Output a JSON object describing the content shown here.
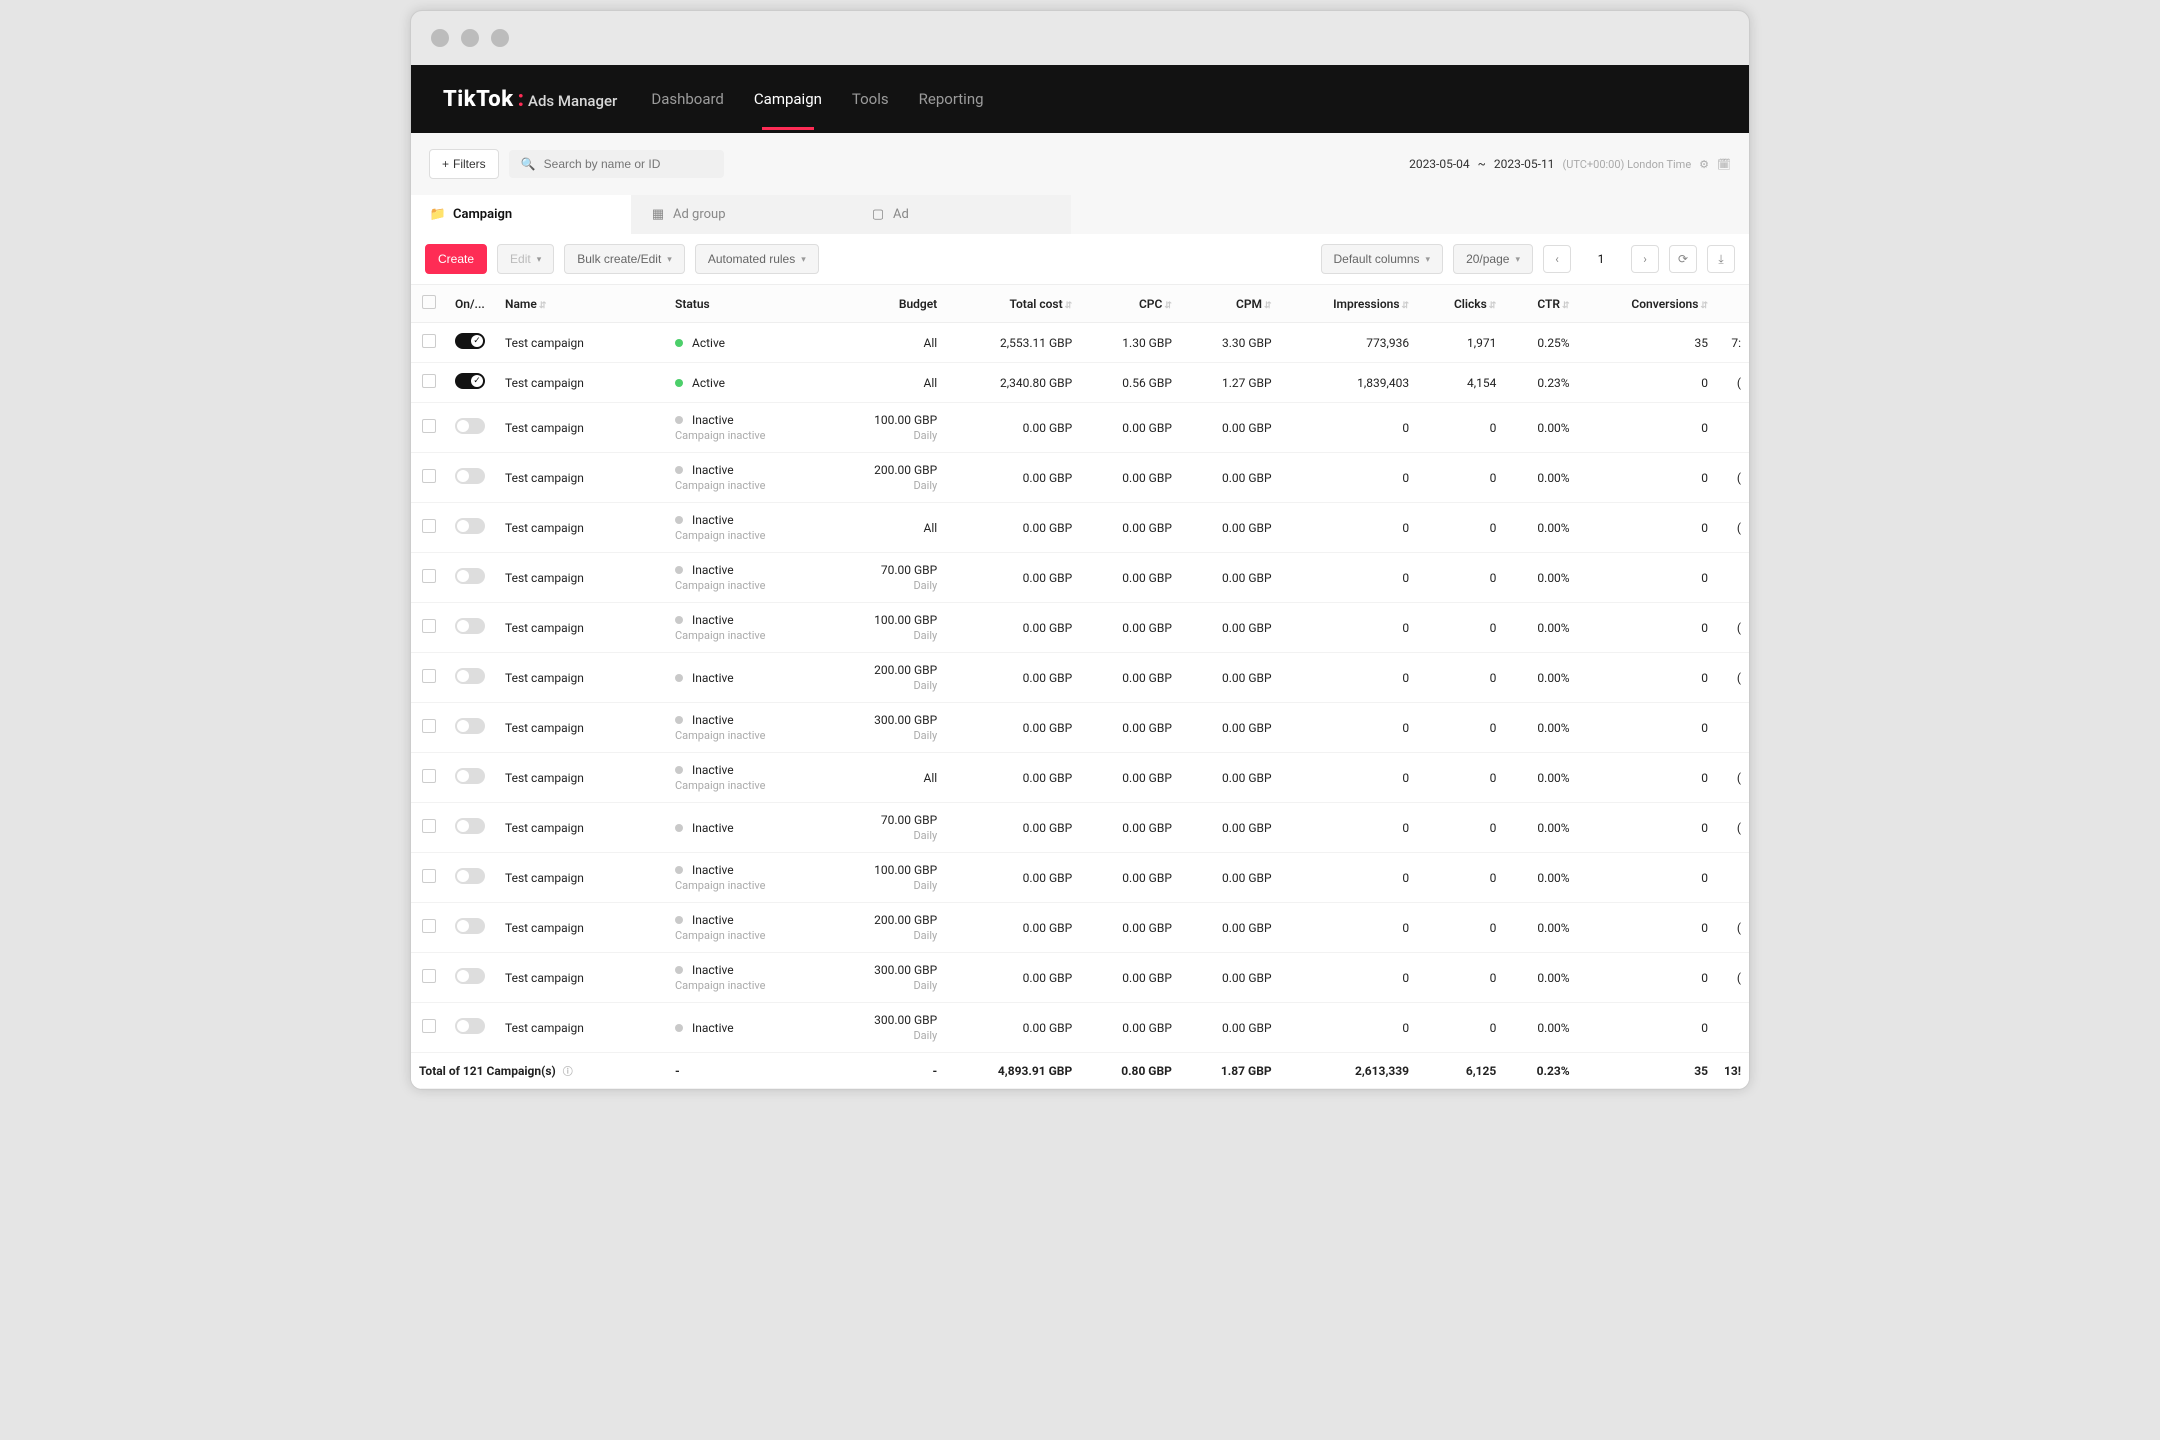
{
  "brand": {
    "name": "TikTok",
    "suffix": "Ads Manager"
  },
  "nav": {
    "dashboard": "Dashboard",
    "campaign": "Campaign",
    "tools": "Tools",
    "reporting": "Reporting"
  },
  "filters": {
    "button": "Filters",
    "search_placeholder": "Search by name or ID",
    "date_from": "2023-05-04",
    "date_to": "2023-05-11",
    "tz": "(UTC+00:00) London Time"
  },
  "tabs": {
    "campaign": "Campaign",
    "adgroup": "Ad group",
    "ad": "Ad"
  },
  "toolbar": {
    "create": "Create",
    "edit": "Edit",
    "bulk": "Bulk create/Edit",
    "rules": "Automated rules",
    "columns": "Default columns",
    "per_page": "20/page",
    "page": "1"
  },
  "columns": {
    "onoff": "On/...",
    "name": "Name",
    "status": "Status",
    "budget": "Budget",
    "total_cost": "Total cost",
    "cpc": "CPC",
    "cpm": "CPM",
    "impressions": "Impressions",
    "clicks": "Clicks",
    "ctr": "CTR",
    "conversions": "Conversions"
  },
  "rows": [
    {
      "on": true,
      "name": "Test campaign",
      "status": "Active",
      "note": "",
      "budget": "All",
      "budget_sub": "",
      "cost": "2,553.11 GBP",
      "cpc": "1.30 GBP",
      "cpm": "3.30 GBP",
      "impr": "773,936",
      "clicks": "1,971",
      "ctr": "0.25%",
      "conv": "35",
      "tail": "7:"
    },
    {
      "on": true,
      "name": "Test campaign",
      "status": "Active",
      "note": "",
      "budget": "All",
      "budget_sub": "",
      "cost": "2,340.80 GBP",
      "cpc": "0.56 GBP",
      "cpm": "1.27 GBP",
      "impr": "1,839,403",
      "clicks": "4,154",
      "ctr": "0.23%",
      "conv": "0",
      "tail": "("
    },
    {
      "on": false,
      "name": "Test campaign",
      "status": "Inactive",
      "note": "Campaign inactive",
      "budget": "100.00 GBP",
      "budget_sub": "Daily",
      "cost": "0.00 GBP",
      "cpc": "0.00 GBP",
      "cpm": "0.00 GBP",
      "impr": "0",
      "clicks": "0",
      "ctr": "0.00%",
      "conv": "0",
      "tail": ""
    },
    {
      "on": false,
      "name": "Test campaign",
      "status": "Inactive",
      "note": "Campaign inactive",
      "budget": "200.00 GBP",
      "budget_sub": "Daily",
      "cost": "0.00 GBP",
      "cpc": "0.00 GBP",
      "cpm": "0.00 GBP",
      "impr": "0",
      "clicks": "0",
      "ctr": "0.00%",
      "conv": "0",
      "tail": "("
    },
    {
      "on": false,
      "name": "Test campaign",
      "status": "Inactive",
      "note": "Campaign inactive",
      "budget": "All",
      "budget_sub": "",
      "cost": "0.00 GBP",
      "cpc": "0.00 GBP",
      "cpm": "0.00 GBP",
      "impr": "0",
      "clicks": "0",
      "ctr": "0.00%",
      "conv": "0",
      "tail": "("
    },
    {
      "on": false,
      "name": "Test campaign",
      "status": "Inactive",
      "note": "Campaign inactive",
      "budget": "70.00 GBP",
      "budget_sub": "Daily",
      "cost": "0.00 GBP",
      "cpc": "0.00 GBP",
      "cpm": "0.00 GBP",
      "impr": "0",
      "clicks": "0",
      "ctr": "0.00%",
      "conv": "0",
      "tail": ""
    },
    {
      "on": false,
      "name": "Test campaign",
      "status": "Inactive",
      "note": "Campaign inactive",
      "budget": "100.00 GBP",
      "budget_sub": "Daily",
      "cost": "0.00 GBP",
      "cpc": "0.00 GBP",
      "cpm": "0.00 GBP",
      "impr": "0",
      "clicks": "0",
      "ctr": "0.00%",
      "conv": "0",
      "tail": "("
    },
    {
      "on": false,
      "name": "Test campaign",
      "status": "Inactive",
      "note": "",
      "budget": "200.00 GBP",
      "budget_sub": "Daily",
      "cost": "0.00 GBP",
      "cpc": "0.00 GBP",
      "cpm": "0.00 GBP",
      "impr": "0",
      "clicks": "0",
      "ctr": "0.00%",
      "conv": "0",
      "tail": "("
    },
    {
      "on": false,
      "name": "Test campaign",
      "status": "Inactive",
      "note": "Campaign inactive",
      "budget": "300.00 GBP",
      "budget_sub": "Daily",
      "cost": "0.00 GBP",
      "cpc": "0.00 GBP",
      "cpm": "0.00 GBP",
      "impr": "0",
      "clicks": "0",
      "ctr": "0.00%",
      "conv": "0",
      "tail": ""
    },
    {
      "on": false,
      "name": "Test campaign",
      "status": "Inactive",
      "note": "Campaign inactive",
      "budget": "All",
      "budget_sub": "",
      "cost": "0.00 GBP",
      "cpc": "0.00 GBP",
      "cpm": "0.00 GBP",
      "impr": "0",
      "clicks": "0",
      "ctr": "0.00%",
      "conv": "0",
      "tail": "("
    },
    {
      "on": false,
      "name": "Test campaign",
      "status": "Inactive",
      "note": "",
      "budget": "70.00 GBP",
      "budget_sub": "Daily",
      "cost": "0.00 GBP",
      "cpc": "0.00 GBP",
      "cpm": "0.00 GBP",
      "impr": "0",
      "clicks": "0",
      "ctr": "0.00%",
      "conv": "0",
      "tail": "("
    },
    {
      "on": false,
      "name": "Test campaign",
      "status": "Inactive",
      "note": "Campaign inactive",
      "budget": "100.00 GBP",
      "budget_sub": "Daily",
      "cost": "0.00 GBP",
      "cpc": "0.00 GBP",
      "cpm": "0.00 GBP",
      "impr": "0",
      "clicks": "0",
      "ctr": "0.00%",
      "conv": "0",
      "tail": ""
    },
    {
      "on": false,
      "name": "Test campaign",
      "status": "Inactive",
      "note": "Campaign inactive",
      "budget": "200.00 GBP",
      "budget_sub": "Daily",
      "cost": "0.00 GBP",
      "cpc": "0.00 GBP",
      "cpm": "0.00 GBP",
      "impr": "0",
      "clicks": "0",
      "ctr": "0.00%",
      "conv": "0",
      "tail": "("
    },
    {
      "on": false,
      "name": "Test campaign",
      "status": "Inactive",
      "note": "Campaign inactive",
      "budget": "300.00 GBP",
      "budget_sub": "Daily",
      "cost": "0.00 GBP",
      "cpc": "0.00 GBP",
      "cpm": "0.00 GBP",
      "impr": "0",
      "clicks": "0",
      "ctr": "0.00%",
      "conv": "0",
      "tail": "("
    },
    {
      "on": false,
      "name": "Test campaign",
      "status": "Inactive",
      "note": "",
      "budget": "300.00 GBP",
      "budget_sub": "Daily",
      "cost": "0.00 GBP",
      "cpc": "0.00 GBP",
      "cpm": "0.00 GBP",
      "impr": "0",
      "clicks": "0",
      "ctr": "0.00%",
      "conv": "0",
      "tail": ""
    }
  ],
  "footer": {
    "label": "Total of 121 Campaign(s)",
    "status": "-",
    "budget": "-",
    "cost": "4,893.91 GBP",
    "cpc": "0.80 GBP",
    "cpm": "1.87 GBP",
    "impr": "2,613,339",
    "clicks": "6,125",
    "ctr": "0.23%",
    "conv": "35",
    "tail": "13!"
  }
}
